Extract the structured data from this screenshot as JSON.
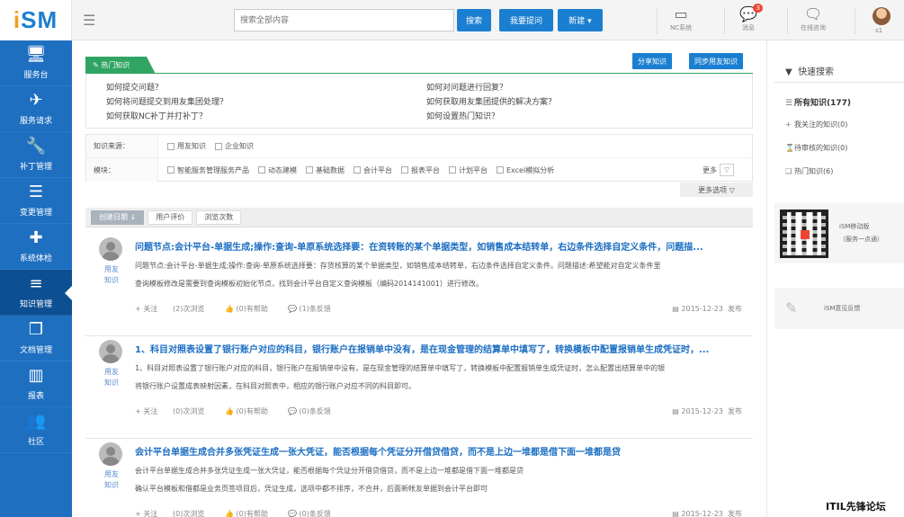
{
  "logo": {
    "text_i": "i",
    "text_sm": "SM"
  },
  "sidebar": {
    "items": [
      {
        "icon": "monitor-icon",
        "glyph": "🖥",
        "label": "服务台"
      },
      {
        "icon": "paper-plane-icon",
        "glyph": "✈",
        "label": "服务请求"
      },
      {
        "icon": "wrench-icon",
        "glyph": "🔧",
        "label": "补丁管理"
      },
      {
        "icon": "server-icon",
        "glyph": "☰",
        "label": "变更管理"
      },
      {
        "icon": "medkit-icon",
        "glyph": "✚",
        "label": "系统体检"
      },
      {
        "icon": "list-icon",
        "glyph": "≡",
        "label": "知识管理"
      },
      {
        "icon": "document-icon",
        "glyph": "❐",
        "label": "文档管理"
      },
      {
        "icon": "bar-chart-icon",
        "glyph": "▥",
        "label": "报表"
      },
      {
        "icon": "community-icon",
        "glyph": "👥",
        "label": "社区"
      }
    ]
  },
  "topbar": {
    "search_placeholder": "搜索全部内容",
    "search_btn": "搜索",
    "ask_btn": "我要提问",
    "new_btn": "新建 ▾",
    "nc_label": "NC系统",
    "msg_label": "消息",
    "msg_count": "3",
    "consult_label": "在线咨询",
    "user_label": "s1"
  },
  "hot": {
    "tab": "热门知识",
    "share_btn": "分享知识",
    "sync_btn": "同步用友知识",
    "questions_left": [
      "如何提交问题？",
      "如何将问题提交到用友集团处理？",
      "如何获取NC补丁并打补丁？"
    ],
    "questions_right": [
      "如何对问题进行回复？",
      "如何获取用友集团提供的解决方案？",
      "如何设置热门知识？"
    ]
  },
  "filter": {
    "source_label": "知识来源：",
    "source_opts": [
      "用友知识",
      "企业知识"
    ],
    "module_label": "模块：",
    "module_opts": [
      "智能服务管理服务产品",
      "动态建模",
      "基础数据",
      "会计平台",
      "报表平台",
      "计划平台",
      "Excel模拟分析"
    ],
    "more": "更多",
    "more_options": "更多选项 ▽"
  },
  "sort": {
    "tabs": [
      "创建日期 ↓",
      "用户评价",
      "浏览次数"
    ]
  },
  "articles": [
    {
      "title": "问题节点:会计平台-单据生成;操作:查询-单原系统选择要：在资转账的某个单据类型，如销售成本结转单，右边条件选择自定义条件，问题描...",
      "author1": "用友",
      "author2": "知识",
      "line1": "问题节点:会计平台-单据生成;操作:查询-单原系统选择要：存货核算的某个单据类型，如销售成本结转单，右边条件选择自定义条件。问题描述:希望能对自定义条件里",
      "line2": "查询模板修改是需要到查询模板初始化节点，找到会计平台自定义查询模板（编码2014141001）进行修改。",
      "follow": "+ 关注",
      "views": "(2)次浏览",
      "helpful": "👍 (0)有帮助",
      "feedback": "💬 (1)条反馈",
      "date": "2015-12-23",
      "publish": "发布"
    },
    {
      "title": "1、科目对照表设置了银行账户对应的科目，银行账户在报销单中没有，是在现金管理的结算单中填写了，转换模板中配置报销单生成凭证时，...",
      "author1": "用友",
      "author2": "知识",
      "line1": "1、科目对照表设置了银行账户对应的科目，银行账户在报销单中没有，是在现金管理的结算单中填写了，转换模板中配置报销单生成凭证时，怎么配置出结算单中的银",
      "line2": "将银行账户设置成表映射因素，在科目对照表中，相应的银行账户对应不同的科目即可。",
      "follow": "+ 关注",
      "views": "(0)次浏览",
      "helpful": "👍 (0)有帮助",
      "feedback": "💬 (0)条反馈",
      "date": "2015-12-23",
      "publish": "发布"
    },
    {
      "title": "会计平台单据生成合并多张凭证生成一张大凭证，能否根据每个凭证分开借贷借贷，而不是上边一堆都是借下面一堆都是贷",
      "author1": "用友",
      "author2": "知识",
      "line1": "会计平台单据生成合并多张凭证生成一张大凭证，能否根据每个凭证分开借贷借贷，而不是上边一堆都是借下面一堆都是贷",
      "line2": "确认平台模板和借都是业务页签项目后，凭证生成，选项中都不排序，不合并，后面新帐友单据到会计平台即可",
      "follow": "+ 关注",
      "views": "(0)次浏览",
      "helpful": "👍 (0)有帮助",
      "feedback": "💬 (0)条反馈",
      "date": "2015-12-23",
      "publish": "发布"
    }
  ],
  "right": {
    "title": "快速搜索",
    "all": "所有知识(177)",
    "items": [
      "我关注的知识(0)",
      "待审核的知识(0)",
      "热门知识(6)"
    ],
    "qr_line1": "iSM移动版",
    "qr_line2": "（服务一点通）",
    "feedback": "iSM意见反馈"
  },
  "watermark": "ITIL先锋论坛"
}
